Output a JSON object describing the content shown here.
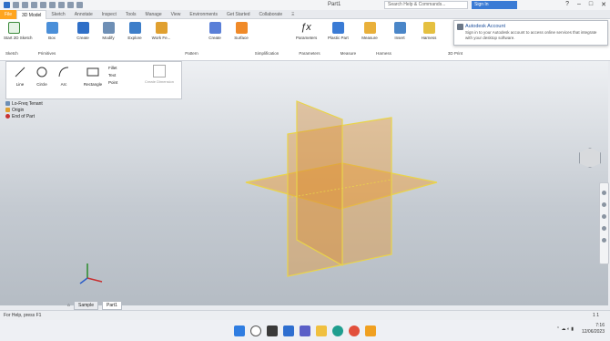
{
  "app": {
    "window_title": "Part1",
    "search_placeholder": "Search Help & Commands...",
    "sign_in_label": "Sign In"
  },
  "colors": {
    "plane_fill": "#e8a24a",
    "plane_edge": "#e9d44a",
    "file_tab": "#ffa51f",
    "accent": "#2f6fc7"
  },
  "tabs": [
    "File",
    "3D Model",
    "Sketch",
    "Annotate",
    "Inspect",
    "Tools",
    "Manage",
    "View",
    "Environments",
    "Get Started",
    "Collaborate",
    "Ξ"
  ],
  "ribbon": {
    "tools": [
      "Start 2D Sketch",
      "Box",
      "Create",
      "Modify",
      "Explore",
      "Work Fe...",
      "Create",
      "Surface",
      "Parameters",
      "Plastic Part",
      "Measure",
      "Insert",
      "Harness"
    ],
    "panel_labels": [
      "Sketch",
      "Primitives",
      "Pattern",
      "Simplification",
      "Parameters",
      "Measure",
      "Harness",
      "3D Print"
    ]
  },
  "sketch_bar": {
    "tools": [
      "Line",
      "Circle",
      "Arc",
      "Rectangle"
    ],
    "small": [
      "Fillet",
      "Text",
      "Point"
    ],
    "extra": "Create Dimension"
  },
  "popup": {
    "title": "Autodesk Account",
    "text": "Sign in to your Autodesk account to access online services that integrate with your desktop software."
  },
  "browser": {
    "items": [
      "Lo-Freq Tenant",
      "Origin",
      "End of Part"
    ]
  },
  "file_tabs": {
    "home_label": "Sample",
    "active_label": "Part1"
  },
  "status": {
    "left": "For Help, press F1",
    "page": "1  1"
  },
  "tray": {
    "time": "7:16",
    "date": "12/06/2023"
  },
  "taskbar_icons": [
    "windows-start-icon",
    "search-icon",
    "task-view-icon",
    "widgets-icon",
    "chat-icon",
    "file-explorer-icon",
    "edge-icon",
    "chrome-icon",
    "inventor-icon"
  ]
}
